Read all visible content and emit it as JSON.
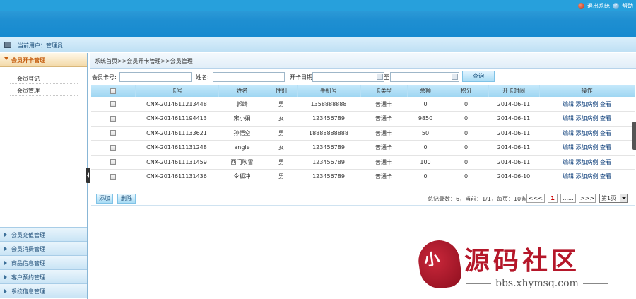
{
  "header": {
    "logout_label": "退出系统",
    "help_label": "帮助"
  },
  "userbar": {
    "text": "当前用户：管理员"
  },
  "sidebar": {
    "active_section": "会员开卡管理",
    "sub_items": [
      "会员登记",
      "会员管理"
    ],
    "sections": [
      "会员充值管理",
      "会员消费管理",
      "商品信息管理",
      "客户预约管理",
      "系统信息管理"
    ]
  },
  "breadcrumb": "系统首页>>会员开卡管理>>会员管理",
  "search": {
    "card_label": "会员卡号:",
    "name_label": "姓名:",
    "date_label": "开卡日期",
    "to_label": "至",
    "query_button": "查询",
    "card_value": "",
    "name_value": "",
    "date_from": "",
    "date_to": ""
  },
  "table": {
    "headers": [
      "卡号",
      "姓名",
      "性别",
      "手机号",
      "卡类型",
      "余额",
      "积分",
      "开卡时间",
      "操作"
    ],
    "rows": [
      [
        "CNX-2014611213448",
        "郭靖",
        "男",
        "1358888888",
        "普通卡",
        "0",
        "0",
        "2014-06-11"
      ],
      [
        "CNX-2014611194413",
        "宋小娟",
        "女",
        "123456789",
        "普通卡",
        "9850",
        "0",
        "2014-06-11"
      ],
      [
        "CNX-2014611133621",
        "孙悟空",
        "男",
        "18888888888",
        "普通卡",
        "50",
        "0",
        "2014-06-11"
      ],
      [
        "CNX-2014611131248",
        "angle",
        "女",
        "123456789",
        "普通卡",
        "0",
        "0",
        "2014-06-11"
      ],
      [
        "CNX-2014611131459",
        "西门吹雪",
        "男",
        "123456789",
        "普通卡",
        "100",
        "0",
        "2014-06-11"
      ],
      [
        "CNX-2014611131436",
        "令狐冲",
        "男",
        "123456789",
        "普通卡",
        "0",
        "0",
        "2014-06-10"
      ]
    ],
    "ops": [
      "编辑",
      "添加病例",
      "查看"
    ]
  },
  "actions": {
    "add": "添加",
    "delete": "删除"
  },
  "pager": {
    "info": "总记录数：6，当前：1/1，每页：10条",
    "first": "<<<",
    "current": "1",
    "ellipsis": "......",
    "next": ">>>",
    "page_select": "第1页"
  },
  "watermark": {
    "seal_text": "小",
    "title": "源码社区",
    "url": "bbs.xhymsq.com"
  }
}
